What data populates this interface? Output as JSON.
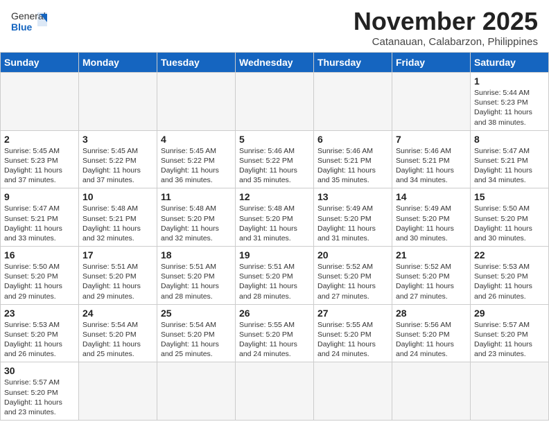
{
  "header": {
    "logo_general": "General",
    "logo_blue": "Blue",
    "month_title": "November 2025",
    "location": "Catanauan, Calabarzon, Philippines"
  },
  "weekdays": [
    "Sunday",
    "Monday",
    "Tuesday",
    "Wednesday",
    "Thursday",
    "Friday",
    "Saturday"
  ],
  "weeks": [
    [
      {
        "day": "",
        "info": ""
      },
      {
        "day": "",
        "info": ""
      },
      {
        "day": "",
        "info": ""
      },
      {
        "day": "",
        "info": ""
      },
      {
        "day": "",
        "info": ""
      },
      {
        "day": "",
        "info": ""
      },
      {
        "day": "1",
        "info": "Sunrise: 5:44 AM\nSunset: 5:23 PM\nDaylight: 11 hours\nand 38 minutes."
      }
    ],
    [
      {
        "day": "2",
        "info": "Sunrise: 5:45 AM\nSunset: 5:23 PM\nDaylight: 11 hours\nand 37 minutes."
      },
      {
        "day": "3",
        "info": "Sunrise: 5:45 AM\nSunset: 5:22 PM\nDaylight: 11 hours\nand 37 minutes."
      },
      {
        "day": "4",
        "info": "Sunrise: 5:45 AM\nSunset: 5:22 PM\nDaylight: 11 hours\nand 36 minutes."
      },
      {
        "day": "5",
        "info": "Sunrise: 5:46 AM\nSunset: 5:22 PM\nDaylight: 11 hours\nand 35 minutes."
      },
      {
        "day": "6",
        "info": "Sunrise: 5:46 AM\nSunset: 5:21 PM\nDaylight: 11 hours\nand 35 minutes."
      },
      {
        "day": "7",
        "info": "Sunrise: 5:46 AM\nSunset: 5:21 PM\nDaylight: 11 hours\nand 34 minutes."
      },
      {
        "day": "8",
        "info": "Sunrise: 5:47 AM\nSunset: 5:21 PM\nDaylight: 11 hours\nand 34 minutes."
      }
    ],
    [
      {
        "day": "9",
        "info": "Sunrise: 5:47 AM\nSunset: 5:21 PM\nDaylight: 11 hours\nand 33 minutes."
      },
      {
        "day": "10",
        "info": "Sunrise: 5:48 AM\nSunset: 5:21 PM\nDaylight: 11 hours\nand 32 minutes."
      },
      {
        "day": "11",
        "info": "Sunrise: 5:48 AM\nSunset: 5:20 PM\nDaylight: 11 hours\nand 32 minutes."
      },
      {
        "day": "12",
        "info": "Sunrise: 5:48 AM\nSunset: 5:20 PM\nDaylight: 11 hours\nand 31 minutes."
      },
      {
        "day": "13",
        "info": "Sunrise: 5:49 AM\nSunset: 5:20 PM\nDaylight: 11 hours\nand 31 minutes."
      },
      {
        "day": "14",
        "info": "Sunrise: 5:49 AM\nSunset: 5:20 PM\nDaylight: 11 hours\nand 30 minutes."
      },
      {
        "day": "15",
        "info": "Sunrise: 5:50 AM\nSunset: 5:20 PM\nDaylight: 11 hours\nand 30 minutes."
      }
    ],
    [
      {
        "day": "16",
        "info": "Sunrise: 5:50 AM\nSunset: 5:20 PM\nDaylight: 11 hours\nand 29 minutes."
      },
      {
        "day": "17",
        "info": "Sunrise: 5:51 AM\nSunset: 5:20 PM\nDaylight: 11 hours\nand 29 minutes."
      },
      {
        "day": "18",
        "info": "Sunrise: 5:51 AM\nSunset: 5:20 PM\nDaylight: 11 hours\nand 28 minutes."
      },
      {
        "day": "19",
        "info": "Sunrise: 5:51 AM\nSunset: 5:20 PM\nDaylight: 11 hours\nand 28 minutes."
      },
      {
        "day": "20",
        "info": "Sunrise: 5:52 AM\nSunset: 5:20 PM\nDaylight: 11 hours\nand 27 minutes."
      },
      {
        "day": "21",
        "info": "Sunrise: 5:52 AM\nSunset: 5:20 PM\nDaylight: 11 hours\nand 27 minutes."
      },
      {
        "day": "22",
        "info": "Sunrise: 5:53 AM\nSunset: 5:20 PM\nDaylight: 11 hours\nand 26 minutes."
      }
    ],
    [
      {
        "day": "23",
        "info": "Sunrise: 5:53 AM\nSunset: 5:20 PM\nDaylight: 11 hours\nand 26 minutes."
      },
      {
        "day": "24",
        "info": "Sunrise: 5:54 AM\nSunset: 5:20 PM\nDaylight: 11 hours\nand 25 minutes."
      },
      {
        "day": "25",
        "info": "Sunrise: 5:54 AM\nSunset: 5:20 PM\nDaylight: 11 hours\nand 25 minutes."
      },
      {
        "day": "26",
        "info": "Sunrise: 5:55 AM\nSunset: 5:20 PM\nDaylight: 11 hours\nand 24 minutes."
      },
      {
        "day": "27",
        "info": "Sunrise: 5:55 AM\nSunset: 5:20 PM\nDaylight: 11 hours\nand 24 minutes."
      },
      {
        "day": "28",
        "info": "Sunrise: 5:56 AM\nSunset: 5:20 PM\nDaylight: 11 hours\nand 24 minutes."
      },
      {
        "day": "29",
        "info": "Sunrise: 5:57 AM\nSunset: 5:20 PM\nDaylight: 11 hours\nand 23 minutes."
      }
    ],
    [
      {
        "day": "30",
        "info": "Sunrise: 5:57 AM\nSunset: 5:20 PM\nDaylight: 11 hours\nand 23 minutes."
      },
      {
        "day": "",
        "info": ""
      },
      {
        "day": "",
        "info": ""
      },
      {
        "day": "",
        "info": ""
      },
      {
        "day": "",
        "info": ""
      },
      {
        "day": "",
        "info": ""
      },
      {
        "day": "",
        "info": ""
      }
    ]
  ]
}
